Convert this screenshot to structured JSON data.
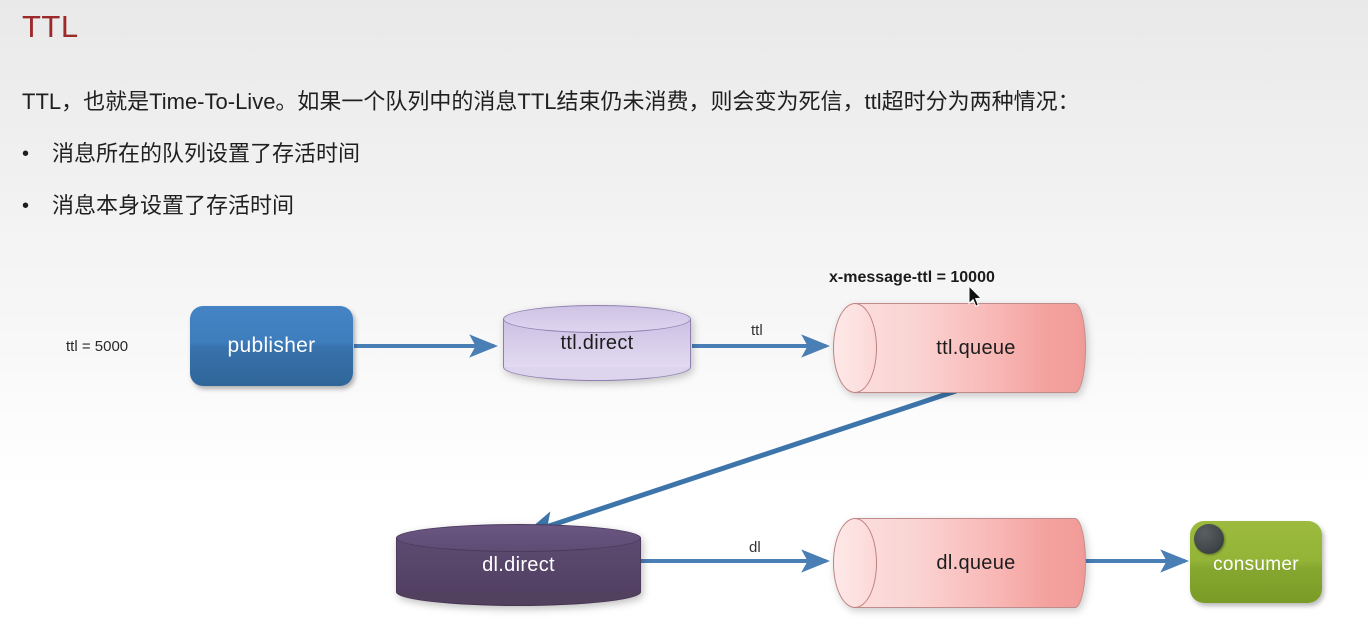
{
  "slide": {
    "title": "TTL",
    "paragraph": "TTL，也就是Time-To-Live。如果一个队列中的消息TTL结束仍未消费，则会变为死信，ttl超时分为两种情况：",
    "bullet_marker": "•",
    "bullets": [
      "消息所在的队列设置了存活时间",
      "消息本身设置了存活时间"
    ]
  },
  "diagram": {
    "labels": {
      "ttl_setting": "ttl = 5000",
      "x_message_ttl": "x-message-ttl = 10000"
    },
    "nodes": {
      "publisher": "publisher",
      "ttl_direct": "ttl.direct",
      "ttl_queue": "ttl.queue",
      "dl_direct": "dl.direct",
      "dl_queue": "dl.queue",
      "consumer": "consumer"
    },
    "edges": {
      "publisher_to_ttl_direct": "",
      "ttl_direct_to_ttl_queue": "ttl",
      "ttl_queue_to_dl_direct": "",
      "dl_direct_to_dl_queue": "dl",
      "dl_queue_to_consumer": ""
    }
  },
  "colors": {
    "title": "#9c2a2a",
    "publisher": "#3e7ebd",
    "ttl_direct": "#d5cbe9",
    "queue_pink": "#f8b9b7",
    "dl_direct": "#58466b",
    "consumer": "#93b437",
    "arrow": "#4a7fb5"
  }
}
